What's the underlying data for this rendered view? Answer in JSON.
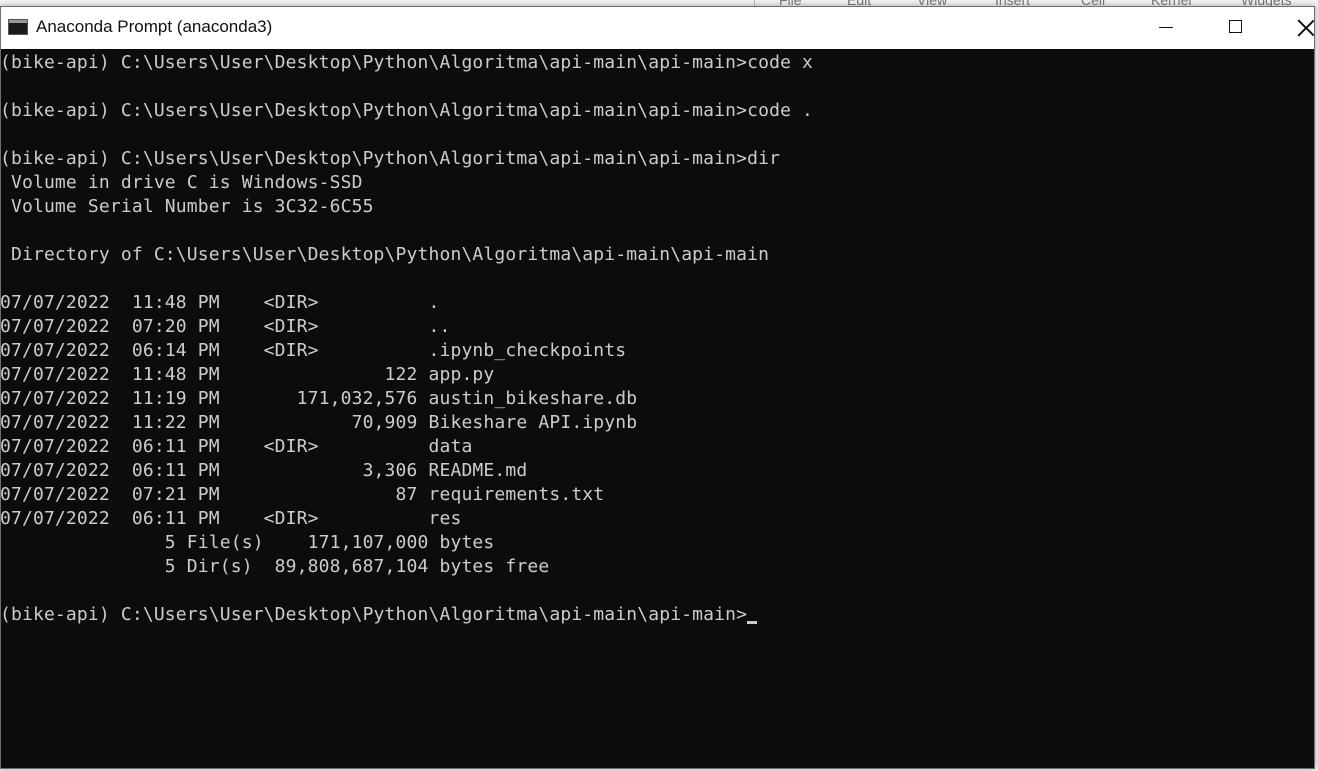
{
  "window": {
    "title": "Anaconda Prompt (anaconda3)",
    "icon": "console-window-icon",
    "controls": {
      "minimize": "minimize-icon",
      "maximize": "maximize-icon",
      "close": "close-icon"
    }
  },
  "background_app": {
    "menu": [
      "File",
      "Edit",
      "View",
      "Insert",
      "Cell",
      "Kernel",
      "Widgets"
    ]
  },
  "console": {
    "lines": [
      "(bike-api) C:\\Users\\User\\Desktop\\Python\\Algoritma\\api-main\\api-main>code x",
      "",
      "(bike-api) C:\\Users\\User\\Desktop\\Python\\Algoritma\\api-main\\api-main>code .",
      "",
      "(bike-api) C:\\Users\\User\\Desktop\\Python\\Algoritma\\api-main\\api-main>dir",
      " Volume in drive C is Windows-SSD",
      " Volume Serial Number is 3C32-6C55",
      "",
      " Directory of C:\\Users\\User\\Desktop\\Python\\Algoritma\\api-main\\api-main",
      "",
      "07/07/2022  11:48 PM    <DIR>          .",
      "07/07/2022  07:20 PM    <DIR>          ..",
      "07/07/2022  06:14 PM    <DIR>          .ipynb_checkpoints",
      "07/07/2022  11:48 PM               122 app.py",
      "07/07/2022  11:19 PM       171,032,576 austin_bikeshare.db",
      "07/07/2022  11:22 PM            70,909 Bikeshare API.ipynb",
      "07/07/2022  06:11 PM    <DIR>          data",
      "07/07/2022  06:11 PM             3,306 README.md",
      "07/07/2022  07:21 PM                87 requirements.txt",
      "07/07/2022  06:11 PM    <DIR>          res",
      "               5 File(s)    171,107,000 bytes",
      "               5 Dir(s)  89,808,687,104 bytes free",
      "",
      "(bike-api) C:\\Users\\User\\Desktop\\Python\\Algoritma\\api-main\\api-main>"
    ]
  },
  "colors": {
    "console_background": "#0c0c0c",
    "console_text": "#cccccc",
    "titlebar": "#ffffff"
  }
}
